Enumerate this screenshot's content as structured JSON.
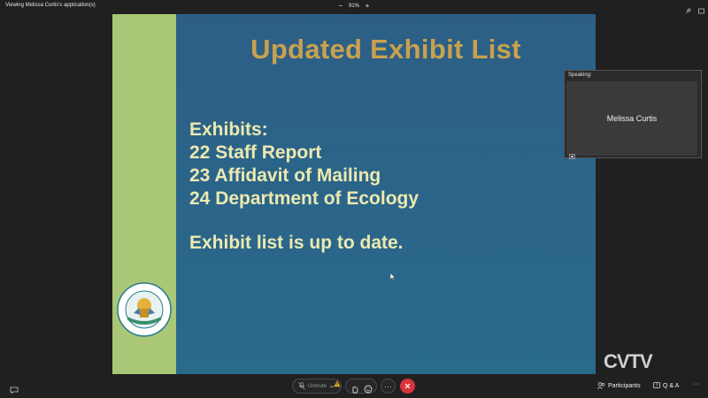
{
  "topbar": {
    "viewing_text": "Viewing Melissa Curtis's application(s)",
    "zoom_minus": "−",
    "zoom_value": "91%",
    "zoom_plus": "+"
  },
  "slide": {
    "title": "Updated Exhibit List",
    "lines": [
      "Exhibits:",
      "22 Staff Report",
      "23 Affidavit of Mailing",
      "24 Department of Ecology"
    ],
    "note": "Exhibit list is up to date.",
    "colors": {
      "title": "#c9a24e",
      "body_text": "#ece9b0",
      "band": "#a9c777",
      "background": "#2b6489"
    }
  },
  "speaking_panel": {
    "label": "Speaking:",
    "speaker_name": "Melissa Curtis"
  },
  "watermark": "CVTV",
  "controls": {
    "unmute_label": "Unmute",
    "more_label": "···",
    "participants_label": "Participants",
    "qa_label": "Q & A",
    "more_right_label": "···",
    "leave_color": "#d7333b"
  },
  "icons": [
    "chat-icon",
    "microphone-icon",
    "warning-icon",
    "raise-hand-icon",
    "emoji-icon",
    "close-icon",
    "participants-icon",
    "qa-icon",
    "seal-logo"
  ]
}
